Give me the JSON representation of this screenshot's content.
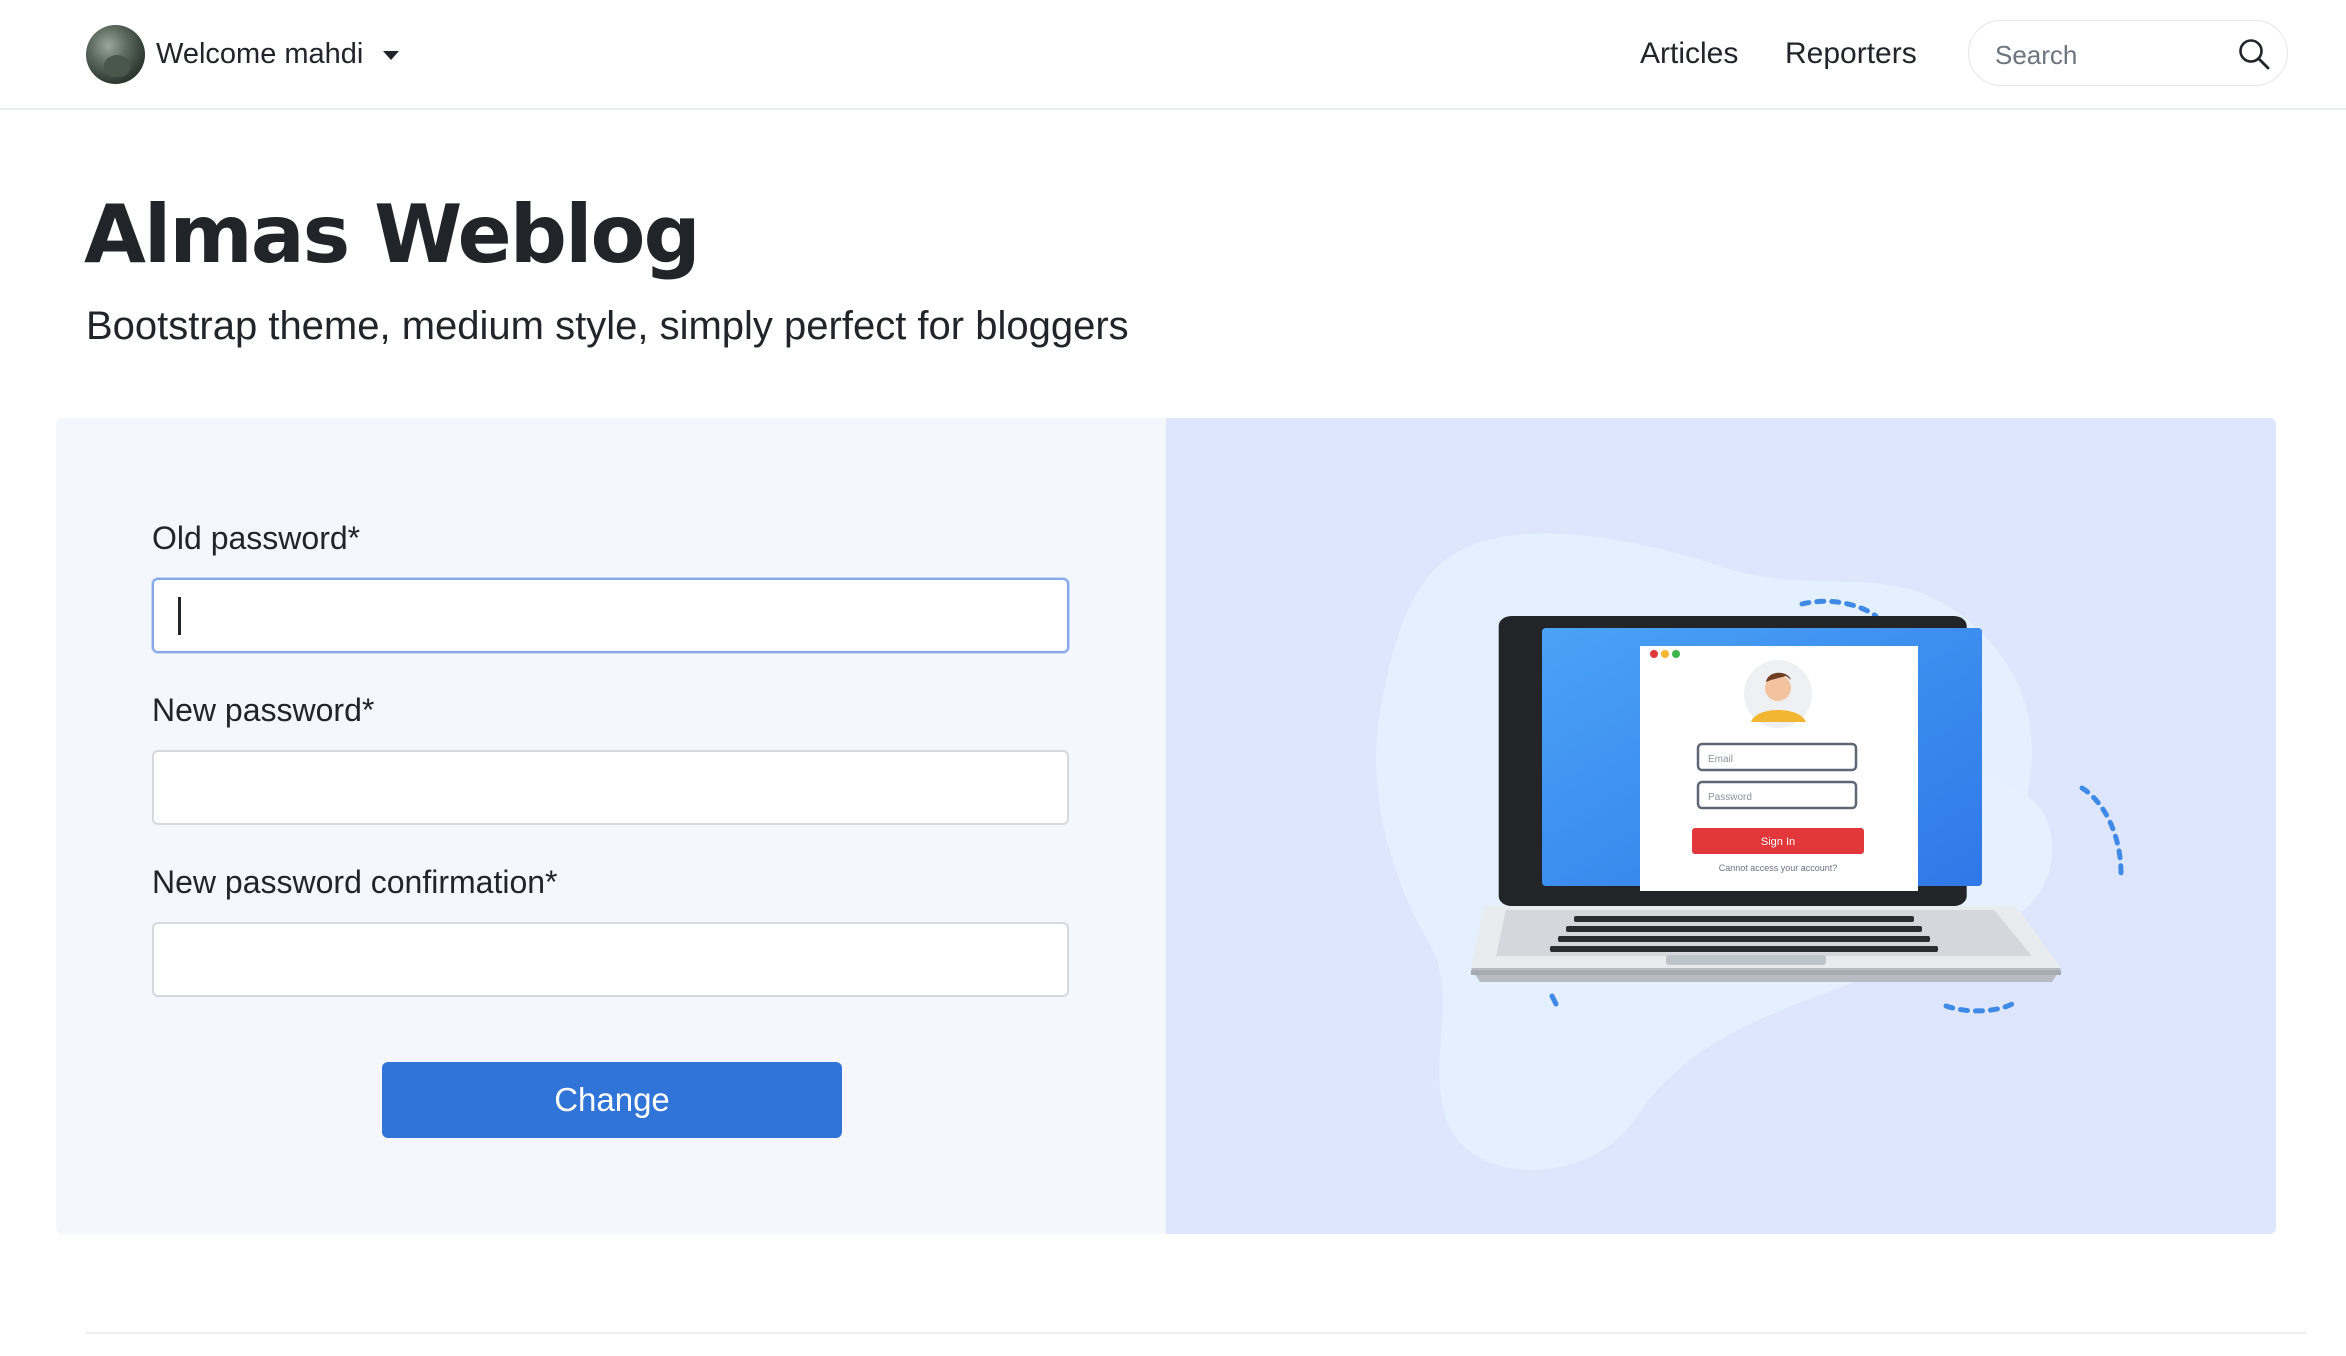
{
  "navbar": {
    "welcome_text": "Welcome mahdi",
    "links": [
      {
        "label": "Articles"
      },
      {
        "label": "Reporters"
      }
    ],
    "search": {
      "placeholder": "Search",
      "value": ""
    }
  },
  "header": {
    "title": "Almas Weblog",
    "subtitle": "Bootstrap theme, medium style, simply perfect for bloggers"
  },
  "form": {
    "fields": [
      {
        "label": "Old password*",
        "value": "",
        "type": "password",
        "focused": true
      },
      {
        "label": "New password*",
        "value": "",
        "type": "password"
      },
      {
        "label": "New password confirmation*",
        "value": "",
        "type": "password"
      }
    ],
    "submit_label": "Change"
  },
  "illustration": {
    "email_placeholder": "Email",
    "password_placeholder": "Password",
    "signin_label": "Sign In",
    "help_text": "Cannot access your account?"
  },
  "colors": {
    "primary_button": "#3174d7",
    "form_panel_bg": "#f4f7fd",
    "image_panel_bg": "#dde6fc",
    "signin_button": "#e2383b"
  }
}
